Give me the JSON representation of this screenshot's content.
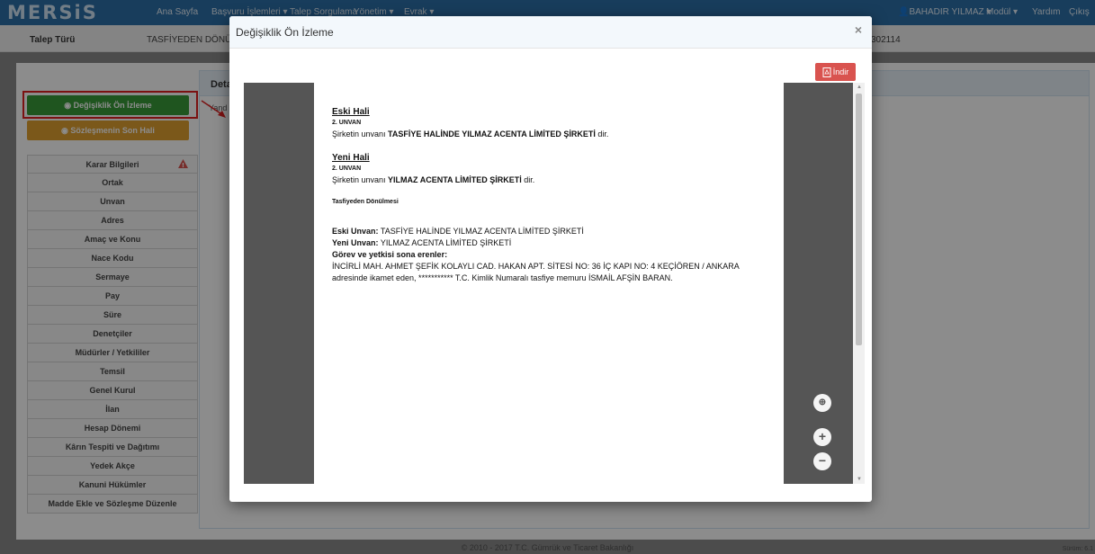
{
  "app": {
    "logo": "MERSiS",
    "nav": {
      "home": "Ana Sayfa",
      "applications": "Başvuru İşlemleri ▾",
      "query": "Talep Sorgulama",
      "management": "Yönetim ▾",
      "documents": "Evrak ▾",
      "user": "BAHADIR YILMAZ ▾",
      "module": "Modül ▾",
      "help": "Yardım",
      "logout": "Çıkış"
    },
    "talep": {
      "label": "Talep Türü",
      "value": "TASFİYEDEN DÖNÜŞ",
      "number": "302114"
    }
  },
  "buttons": {
    "preview": "Değişiklik Ön İzleme",
    "final": "Sözleşmenin Son Hali"
  },
  "sidebar": {
    "items": [
      {
        "label": "Karar Bilgileri"
      },
      {
        "label": "Ortak"
      },
      {
        "label": "Unvan"
      },
      {
        "label": "Adres"
      },
      {
        "label": "Amaç ve Konu"
      },
      {
        "label": "Nace Kodu"
      },
      {
        "label": "Sermaye"
      },
      {
        "label": "Pay"
      },
      {
        "label": "Süre"
      },
      {
        "label": "Denetçiler"
      },
      {
        "label": "Müdürler / Yetkililer"
      },
      {
        "label": "Temsil"
      },
      {
        "label": "Genel Kurul"
      },
      {
        "label": "İlan"
      },
      {
        "label": "Hesap Dönemi"
      },
      {
        "label": "Kârın Tespiti ve Dağıtımı"
      },
      {
        "label": "Yedek Akçe"
      },
      {
        "label": "Kanuni Hükümler"
      },
      {
        "label": "Madde Ekle ve Sözleşme Düzenle"
      }
    ]
  },
  "detail": {
    "title": "Deta",
    "subtitle": "Yand"
  },
  "modal": {
    "title": "Değişiklik Ön İzleme",
    "close": "×",
    "download": "İndir"
  },
  "document": {
    "old_heading": "Eski Hali",
    "old_article": "2. UNVAN",
    "old_prefix": "Şirketin unvanı ",
    "old_name": "TASFİYE HALİNDE YILMAZ ACENTA LİMİTED ŞİRKETİ",
    "old_suffix": " dir.",
    "new_heading": "Yeni Hali",
    "new_article": "2. UNVAN",
    "new_prefix": "Şirketin unvanı ",
    "new_name": "YILMAZ ACENTA LİMİTED ŞİRKETİ",
    "new_suffix": " dir.",
    "section_title": "Tasfiyeden Dönülmesi",
    "old_title_label": "Eski Unvan:",
    "old_title_value": " TASFİYE HALİNDE YILMAZ ACENTA LİMİTED ŞİRKETİ",
    "new_title_label": "Yeni Unvan:",
    "new_title_value": " YILMAZ ACENTA LİMİTED ŞİRKETİ",
    "duty_label": "Görev ve yetkisi sona erenler:",
    "duty_text": "İNCİRLİ MAH. AHMET ŞEFİK KOLAYLI CAD. HAKAN APT. SİTESİ NO: 36 İÇ KAPI NO: 4 KEÇİÖREN / ANKARA adresinde ikamet eden, *********** T.C. Kimlik Numaralı tasfiye memuru İSMAİL AFŞİN BARAN."
  },
  "footer": {
    "text": "© 2010 - 2017  T.C. Gümrük ve Ticaret Bakanlığı",
    "version": "Sürüm: 6.1"
  },
  "colors": {
    "navbar": "#2d6fa8",
    "green": "#3a9b3a",
    "orange": "#e0a030",
    "danger": "#d9534f"
  }
}
